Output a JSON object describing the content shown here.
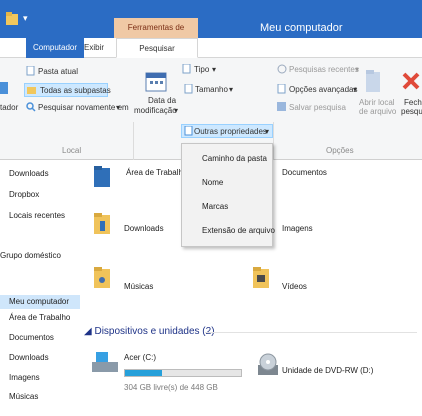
{
  "window": {
    "title": "Meu computador",
    "context_tab": "Ferramentas de Pesquisa",
    "qat_arrow": "▾"
  },
  "tabs": [
    {
      "label": "Computador"
    },
    {
      "label": "Exibir"
    },
    {
      "label": "Pesquisar",
      "active": true
    }
  ],
  "ribbon": {
    "local": {
      "current_folder": "Pasta atual",
      "all_subfolders": "Todas as subpastas",
      "search_again": "Pesquisar novamente em",
      "this_pc_partial": "tador",
      "label": "Local"
    },
    "refine": {
      "date_modified": "Data da modificação",
      "date_line1": "Data da",
      "date_line2": "modificação",
      "kind": "Tipo",
      "size": "Tamanho",
      "other_props": "Outras propriedades"
    },
    "options": {
      "recent_searches": "Pesquisas recentes",
      "advanced_options": "Opções avançadas",
      "save_search": "Salvar pesquisa",
      "open_location_line1": "Abrir local",
      "open_location_line2": "de arquivo",
      "close_line1": "Fecha",
      "close_line2": "pesqui",
      "label": "Opções"
    }
  },
  "dropdown": {
    "items": [
      "Caminho da pasta",
      "Nome",
      "Marcas",
      "Extensão de arquivo"
    ]
  },
  "nav": {
    "items": [
      "Downloads",
      "Dropbox",
      "Locais recentes",
      "Grupo doméstico",
      "Meu computador",
      "Área de Trabalho",
      "Documentos",
      "Downloads",
      "Imagens",
      "Músicas"
    ],
    "selected": "Meu computador"
  },
  "folders": [
    "Área de Trabalho",
    "Documentos",
    "Downloads",
    "Imagens",
    "Músicas",
    "Vídeos"
  ],
  "devices": {
    "section_title": "Dispositivos e unidades (2)",
    "drive": {
      "name": "Acer (C:)",
      "free_text": "304 GB livre(s) de 448 GB",
      "used_fraction": 0.32
    },
    "dvd": {
      "name": "Unidade de DVD-RW (D:)"
    }
  },
  "colors": {
    "accent": "#2b6cc4",
    "context": "#f0c9a5",
    "bar": "#26a0da"
  }
}
